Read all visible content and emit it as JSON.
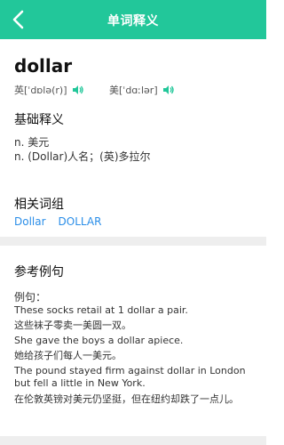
{
  "header": {
    "title": "单词释义",
    "background": "#22c79a"
  },
  "word": {
    "text": "dollar",
    "uk": {
      "label": "英",
      "phonetic": "[ˈdɒlə(r)]"
    },
    "us": {
      "label": "美",
      "phonetic": "[ˈdɑːlər]"
    },
    "speaker_icon": "speaker-icon"
  },
  "basic": {
    "title": "基础释义",
    "definitions": [
      "n. 美元",
      "n. (Dollar)人名；(英)多拉尔"
    ]
  },
  "phrases": {
    "title": "相关词组",
    "items": [
      "Dollar",
      "DOLLAR"
    ],
    "link_color": "#2b8ee8"
  },
  "examples": {
    "title": "参考例句",
    "label": "例句：",
    "items": [
      {
        "en": "These socks retail at 1 dollar a pair.",
        "zh": "这些袜子零卖一美圆一双。"
      },
      {
        "en": "She gave the boys a dollar apiece.",
        "zh": "她给孩子们每人一美元。"
      },
      {
        "en": "The pound stayed firm against dollar in London but fell a little in New York.",
        "zh": "在伦敦英镑对美元仍坚挺，但在纽约却跌了一点儿。"
      }
    ]
  }
}
